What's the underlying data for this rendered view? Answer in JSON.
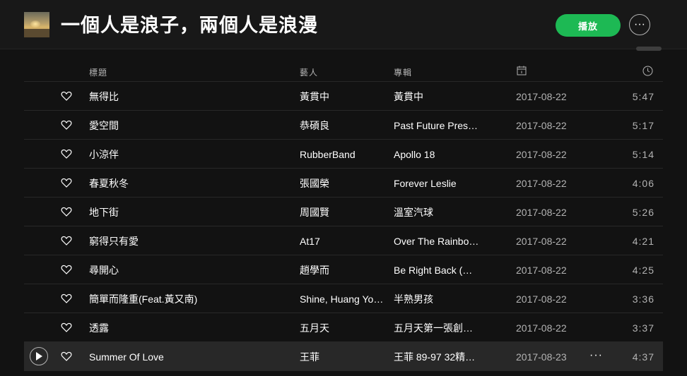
{
  "playlist": {
    "title": "一個人是浪子，兩個人是浪漫",
    "play_label": "播放",
    "more_label": "···"
  },
  "columns": {
    "title": "標題",
    "artist": "藝人",
    "album": "專輯"
  },
  "tracks": [
    {
      "title": "無得比",
      "artist": "黃貫中",
      "album": "黃貫中",
      "date": "2017-08-22",
      "duration": "5:47"
    },
    {
      "title": "愛空間",
      "artist": "恭碩良",
      "album": "Past Future Prese…",
      "date": "2017-08-22",
      "duration": "5:17"
    },
    {
      "title": "小涼伴",
      "artist": "RubberBand",
      "album": "Apollo 18",
      "date": "2017-08-22",
      "duration": "5:14"
    },
    {
      "title": "春夏秋冬",
      "artist": "張國榮",
      "album": "Forever Leslie",
      "date": "2017-08-22",
      "duration": "4:06"
    },
    {
      "title": "地下街",
      "artist": "周國賢",
      "album": "溫室汽球",
      "date": "2017-08-22",
      "duration": "5:26"
    },
    {
      "title": "窮得只有愛",
      "artist": "At17",
      "album": "Over The Rainbo…",
      "date": "2017-08-22",
      "duration": "4:21"
    },
    {
      "title": "尋開心",
      "artist": "趙學而",
      "album": "Be Right Back (精…",
      "date": "2017-08-22",
      "duration": "4:25"
    },
    {
      "title": "簡單而隆重(Feat.黃又南)",
      "artist": "Shine, Huang You…",
      "album": "半熟男孩",
      "date": "2017-08-22",
      "duration": "3:36"
    },
    {
      "title": "透露",
      "artist": "五月天",
      "album": "五月天第一張創…",
      "date": "2017-08-22",
      "duration": "3:37"
    },
    {
      "title": "Summer Of Love",
      "artist": "王菲",
      "album": "王菲 89-97 32精…",
      "date": "2017-08-23",
      "duration": "4:37",
      "hovered": true,
      "more_label": "···"
    }
  ],
  "icons": {
    "cover": "album-cover",
    "date_column": "calendar-icon",
    "duration_column": "clock-icon",
    "like": "heart-icon",
    "row_play": "play-icon"
  },
  "colors": {
    "accent": "#1db954",
    "background": "#121212",
    "header": "#181818",
    "row_hover": "#282828",
    "muted_text": "#b3b3b3"
  }
}
